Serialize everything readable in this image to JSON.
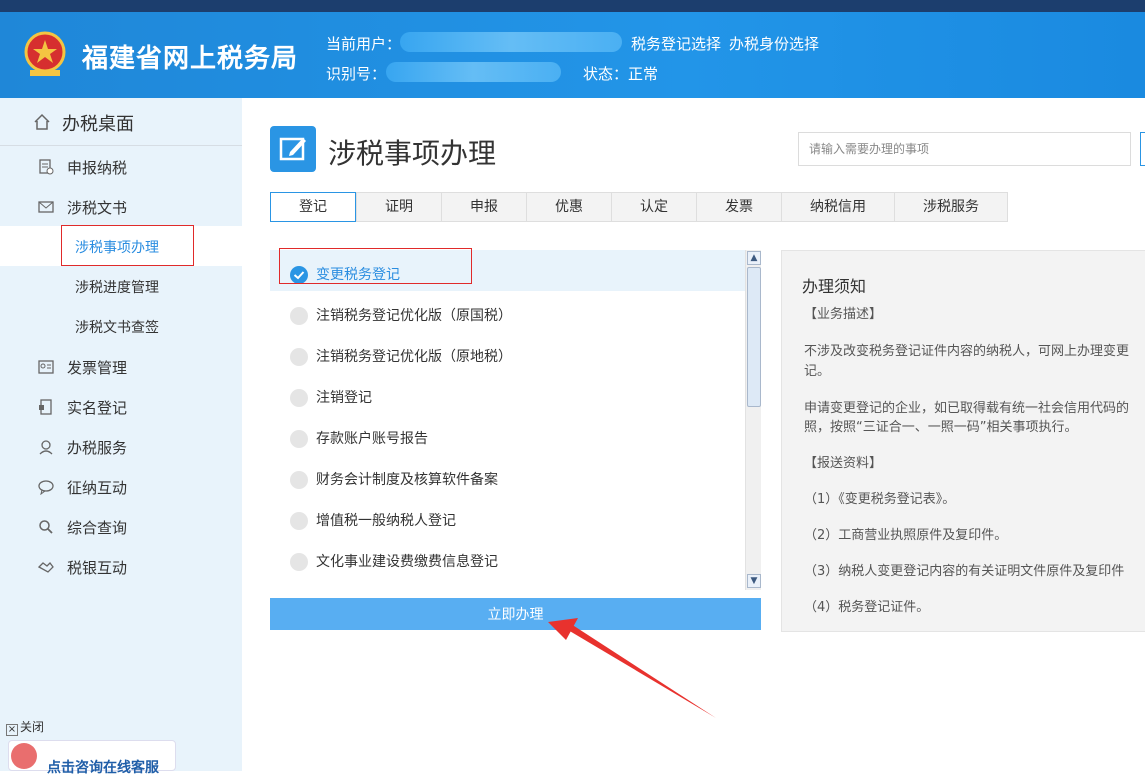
{
  "header": {
    "site_title": "福建省网上税务局",
    "current_user_label": "当前用户：",
    "id_label": "识别号：",
    "tax_reg_select": "税务登记选择",
    "tax_identity_select": "办税身份选择",
    "status_label": "状态：正常",
    "brand_color": "#2295e8"
  },
  "sidebar": {
    "home": "办税桌面",
    "items": [
      {
        "label": "申报纳税",
        "icon": "report-icon"
      },
      {
        "label": "涉税文书",
        "icon": "mail-icon"
      },
      {
        "label": "发票管理",
        "icon": "invoice-icon"
      },
      {
        "label": "实名登记",
        "icon": "id-card-icon"
      },
      {
        "label": "办税服务",
        "icon": "user-service-icon"
      },
      {
        "label": "征纳互动",
        "icon": "chat-icon"
      },
      {
        "label": "综合查询",
        "icon": "search-icon"
      },
      {
        "label": "税银互动",
        "icon": "handshake-icon"
      }
    ],
    "subitems": [
      "涉税事项办理",
      "涉税进度管理",
      "涉税文书查签"
    ],
    "close": "关闭",
    "consult": "点击咨询在线客服"
  },
  "main": {
    "title": "涉税事项办理",
    "search_placeholder": "请输入需要办理的事项",
    "tabs": [
      "登记",
      "证明",
      "申报",
      "优惠",
      "认定",
      "发票",
      "纳税信用",
      "涉税服务"
    ],
    "items": [
      "变更税务登记",
      "注销税务登记优化版（原国税）",
      "注销税务登记优化版（原地税）",
      "注销登记",
      "存款账户账号报告",
      "财务会计制度及核算软件备案",
      "增值税一般纳税人登记",
      "文化事业建设费缴费信息登记"
    ],
    "action_button": "立即办理"
  },
  "notice": {
    "title": "办理须知",
    "business_desc_heading": "【业务描述】",
    "desc1_line1": "不涉及改变税务登记证件内容的纳税人，可网上办理变更",
    "desc1_line2": "记。",
    "desc2_line1": "申请变更登记的企业，如已取得载有统一社会信用代码的",
    "desc2_line2": "照，按照“三证合一、一照一码”相关事项执行。",
    "materials_heading": "【报送资料】",
    "materials": [
      "（1）《变更税务登记表》。",
      "（2）工商营业执照原件及复印件。",
      "（3）纳税人变更登记内容的有关证明文件原件及复印件",
      "（4）税务登记证件。"
    ]
  }
}
